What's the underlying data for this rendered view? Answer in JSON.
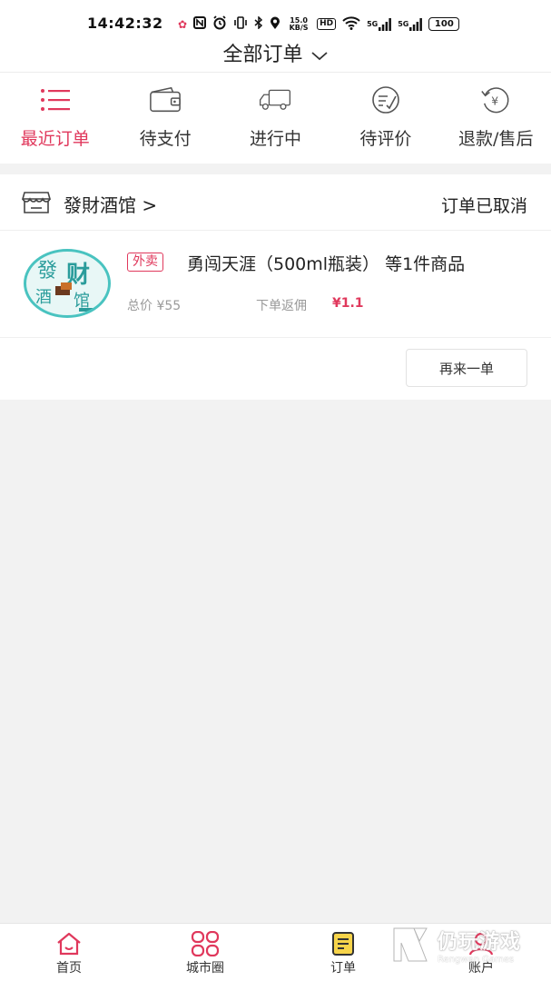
{
  "status_bar": {
    "time": "14:42:32",
    "net_speed": "15.0 KB/S",
    "hd": "HD",
    "signal_1": "5G",
    "signal_2": "5G",
    "battery": "100"
  },
  "header": {
    "title": "全部订单"
  },
  "tabs": [
    {
      "label": "最近订单",
      "icon": "list-icon",
      "active": true
    },
    {
      "label": "待支付",
      "icon": "wallet-icon",
      "active": false
    },
    {
      "label": "进行中",
      "icon": "truck-icon",
      "active": false
    },
    {
      "label": "待评价",
      "icon": "review-icon",
      "active": false
    },
    {
      "label": "退款/售后",
      "icon": "refund-icon",
      "active": false
    }
  ],
  "order": {
    "shop_name": "發財酒馆 >",
    "status": "订单已取消",
    "logo_text": "發财酒馆",
    "tag": "外卖",
    "goods_title": "勇闯天涯（500ml瓶装） 等1件商品",
    "price_label": "总价 ¥55",
    "rebate_label": "下单返佣",
    "rebate_value": "¥1.1",
    "reorder_label": "再来一单"
  },
  "bottom_nav": [
    {
      "label": "首页",
      "icon": "home-icon"
    },
    {
      "label": "城市圈",
      "icon": "city-circle-icon"
    },
    {
      "label": "订单",
      "icon": "order-icon"
    },
    {
      "label": "账户",
      "icon": "account-icon"
    }
  ],
  "watermark": {
    "cn": "仍玩游戏",
    "en": "Rengwan Games"
  },
  "colors": {
    "accent": "#e0385c",
    "logo_ring": "#49c3c0",
    "background": "#f2f2f2"
  }
}
